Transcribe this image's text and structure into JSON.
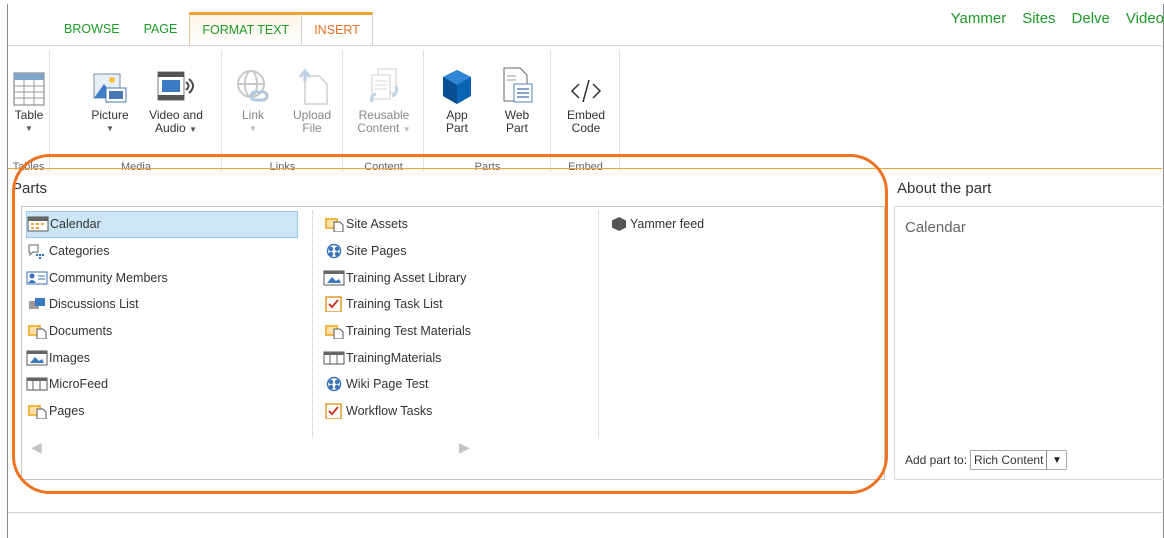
{
  "tabs": [
    {
      "label": "BROWSE"
    },
    {
      "label": "PAGE"
    },
    {
      "label": "FORMAT TEXT"
    },
    {
      "label": "INSERT"
    }
  ],
  "top_links": [
    "Yammer",
    "Sites",
    "Delve",
    "Video"
  ],
  "ribbon": {
    "groups": {
      "tables": "Tables",
      "media": "Media",
      "links": "Links",
      "content": "Content",
      "parts": "Parts",
      "embed": "Embed"
    },
    "buttons": {
      "table": "Table",
      "picture": "Picture",
      "video_1": "Video and",
      "video_2": "Audio",
      "link": "Link",
      "upload_1": "Upload",
      "upload_2": "File",
      "reusable_1": "Reusable",
      "reusable_2": "Content",
      "app_1": "App",
      "app_2": "Part",
      "web_1": "Web",
      "web_2": "Part",
      "embed_1": "Embed",
      "embed_2": "Code"
    }
  },
  "parts_panel": {
    "title": "Parts",
    "columns": [
      [
        "Calendar",
        "Categories",
        "Community Members",
        "Discussions List",
        "Documents",
        "Images",
        "MicroFeed",
        "Pages"
      ],
      [
        "Site Assets",
        "Site Pages",
        "Training Asset Library",
        "Training Task List",
        "Training Test Materials",
        "TrainingMaterials",
        "Wiki Page Test",
        "Workflow Tasks"
      ],
      [
        "Yammer feed"
      ]
    ],
    "selected": "Calendar"
  },
  "about_panel": {
    "title": "About the part",
    "part_name": "Calendar",
    "add_part_label": "Add part to:",
    "add_part_value": "Rich Content"
  },
  "colors": {
    "accent_green": "#1f9a28",
    "accent_orange": "#ee7322",
    "selection_blue": "#cde6f7"
  }
}
